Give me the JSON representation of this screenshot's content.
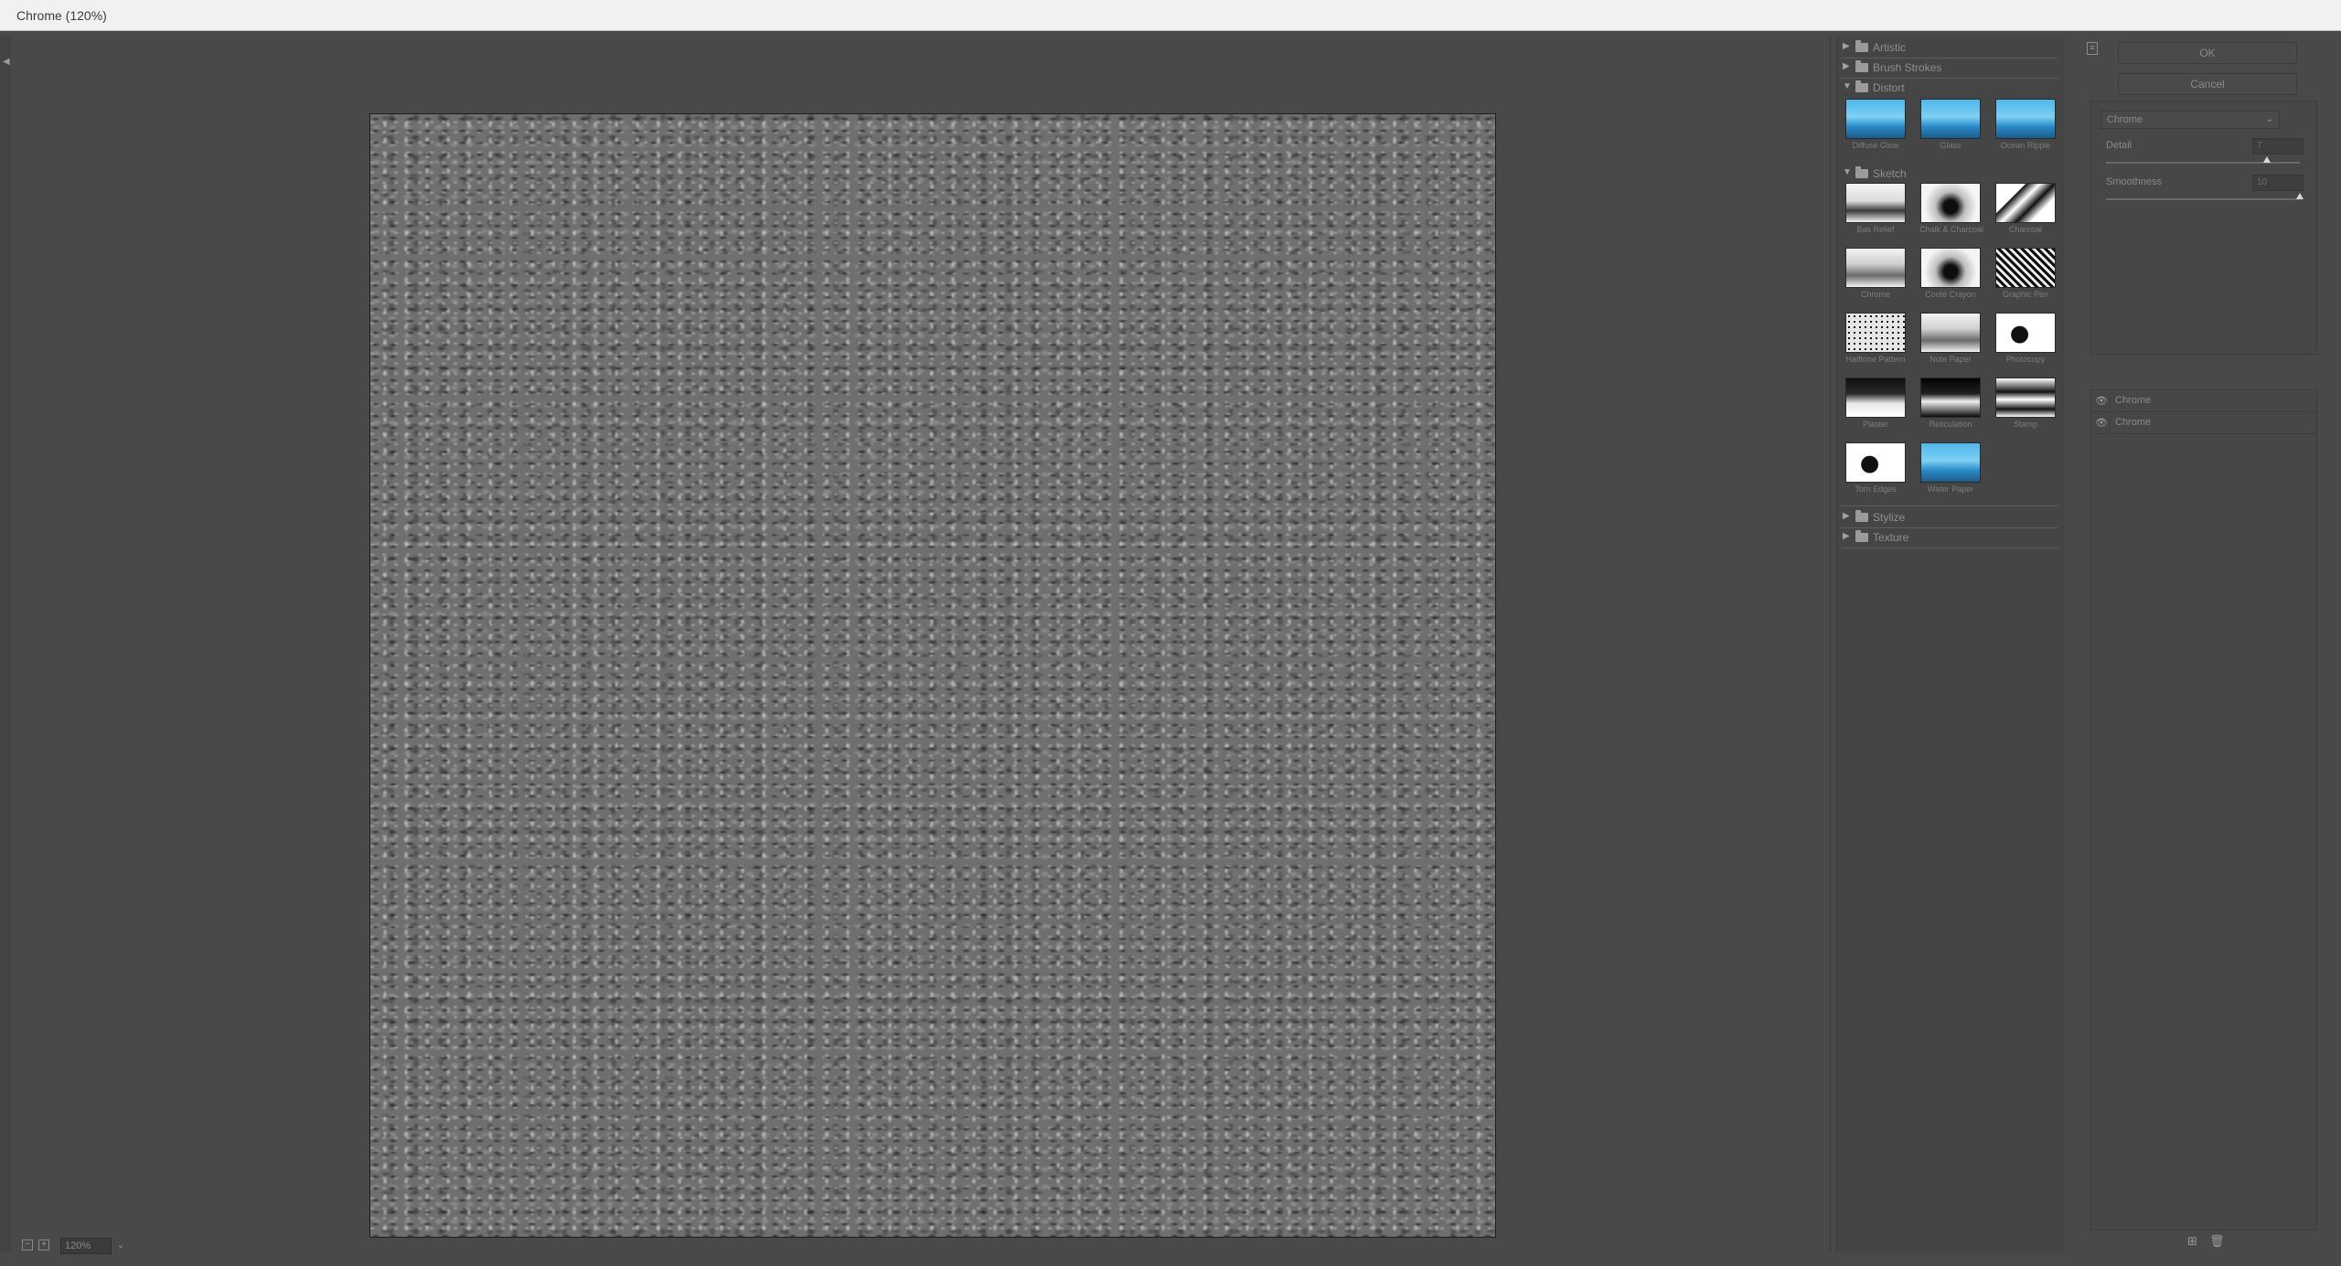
{
  "window": {
    "title": "Chrome (120%)"
  },
  "bottom_bar": {
    "zoom": "120%"
  },
  "gallery": {
    "folders": [
      {
        "label": "Artistic",
        "expanded": false
      },
      {
        "label": "Brush Strokes",
        "expanded": false
      },
      {
        "label": "Distort",
        "expanded": true,
        "items": [
          "Diffuse Glow",
          "Glass",
          "Ocean Ripple"
        ]
      },
      {
        "label": "Sketch",
        "expanded": true,
        "items": [
          "Bas Relief",
          "Chalk & Charcoal",
          "Charcoal",
          "Chrome",
          "Conté Crayon",
          "Graphic Pen",
          "Halftone Pattern",
          "Note Paper",
          "Photocopy",
          "Plaster",
          "Reticulation",
          "Stamp",
          "Torn Edges",
          "Water Paper"
        ]
      },
      {
        "label": "Stylize",
        "expanded": false
      },
      {
        "label": "Texture",
        "expanded": false
      }
    ]
  },
  "settings": {
    "ok_label": "OK",
    "cancel_label": "Cancel",
    "selected_filter": "Chrome",
    "params": [
      {
        "label": "Detail",
        "value": "7",
        "level": 0.83
      },
      {
        "label": "Smoothness",
        "value": "10",
        "level": 1.0
      }
    ]
  },
  "layers": [
    {
      "name": "Chrome"
    },
    {
      "name": "Chrome"
    }
  ]
}
